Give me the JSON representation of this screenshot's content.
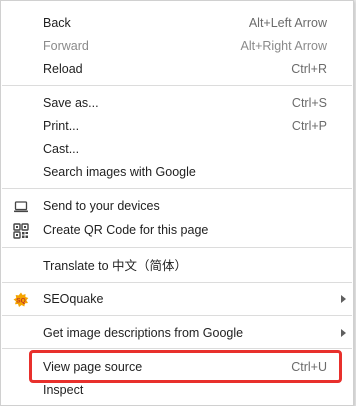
{
  "menu": {
    "back": {
      "label": "Back",
      "shortcut": "Alt+Left Arrow"
    },
    "forward": {
      "label": "Forward",
      "shortcut": "Alt+Right Arrow"
    },
    "reload": {
      "label": "Reload",
      "shortcut": "Ctrl+R"
    },
    "save_as": {
      "label": "Save as...",
      "shortcut": "Ctrl+S"
    },
    "print": {
      "label": "Print...",
      "shortcut": "Ctrl+P"
    },
    "cast": {
      "label": "Cast..."
    },
    "search_images": {
      "label": "Search images with Google"
    },
    "send_devices": {
      "label": "Send to your devices",
      "icon": "laptop-icon"
    },
    "qr_code": {
      "label": "Create QR Code for this page",
      "icon": "qr-code-icon"
    },
    "translate": {
      "label": "Translate to 中文（简体）"
    },
    "seoquake": {
      "label": "SEOquake",
      "icon": "seoquake-icon"
    },
    "image_descriptions": {
      "label": "Get image descriptions from Google"
    },
    "view_source": {
      "label": "View page source",
      "shortcut": "Ctrl+U"
    },
    "inspect": {
      "label": "Inspect"
    }
  },
  "colors": {
    "highlight": "#e8302c",
    "text": "#1f1f1f",
    "disabled_text": "#8a8a8a",
    "separator": "#dcdcdc",
    "seoquake_logo": "#f5a400"
  }
}
